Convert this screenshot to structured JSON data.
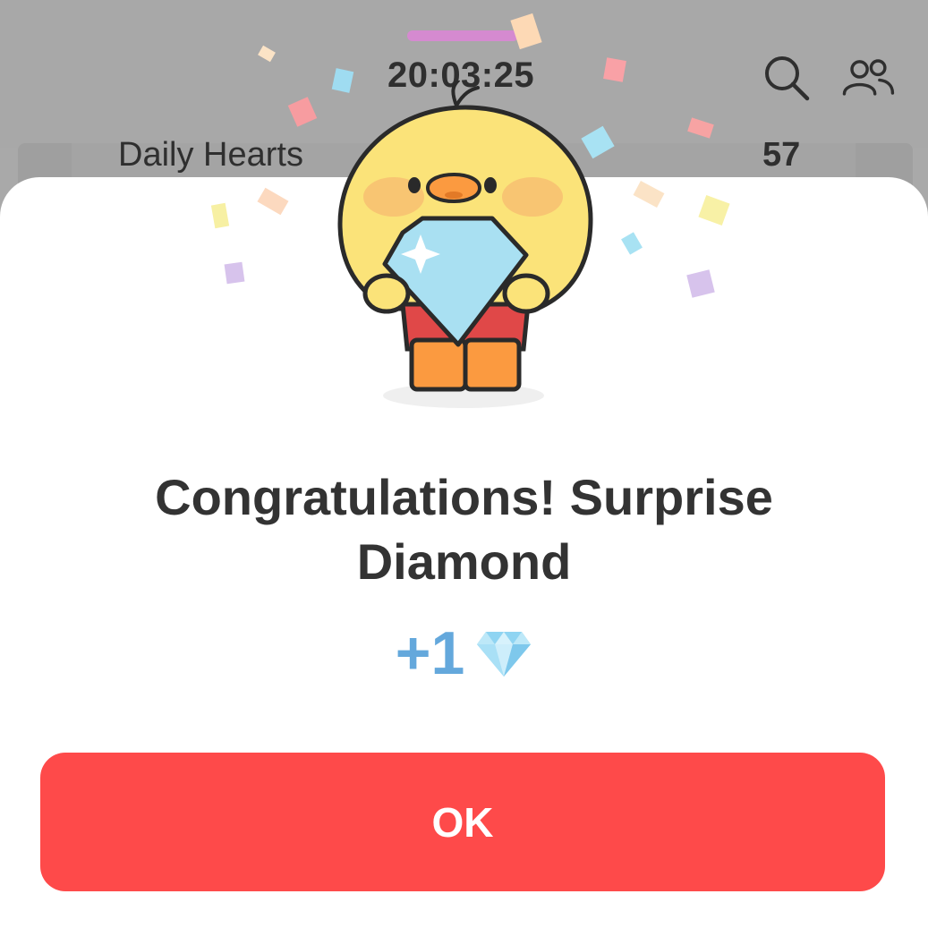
{
  "background": {
    "clock": "20:03:25",
    "card_label": "Daily Hearts",
    "card_count": "57",
    "icons": [
      "search-icon",
      "friends-icon"
    ]
  },
  "dialog": {
    "title": "Congratulations! Surprise Diamond",
    "reward_amount": "+1",
    "reward_icon": "diamond-icon",
    "ok_label": "OK",
    "mascot": "duck-holding-diamond"
  },
  "colors": {
    "accent": "#fe4a4a",
    "reward_blue": "#64a8dc",
    "overlay": "#a9a9a9",
    "title_text": "#333333"
  }
}
